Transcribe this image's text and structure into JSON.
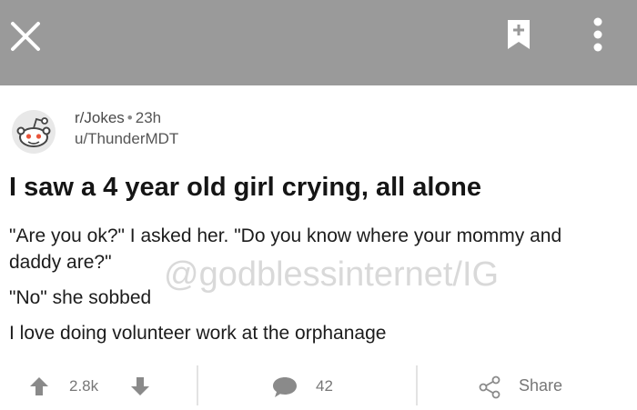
{
  "toolbar": {
    "close_icon": "close-icon",
    "bookmark_icon": "bookmark-add-icon",
    "more_icon": "more-vertical-icon",
    "background_color": "#9a9a9a"
  },
  "post": {
    "subreddit": "r/Jokes",
    "separator": "•",
    "age": "23h",
    "author": "u/ThunderMDT",
    "title": "I saw a 4 year old girl crying, all alone",
    "paragraphs": [
      "\"Are you ok?\" I asked her. \"Do you know where your mommy and daddy are?\"",
      "\"No\" she sobbed",
      "I love doing volunteer work at the orphanage"
    ]
  },
  "watermark": "@godblessinternet/IG",
  "actions": {
    "score": "2.8k",
    "comments": "42",
    "share_label": "Share"
  }
}
